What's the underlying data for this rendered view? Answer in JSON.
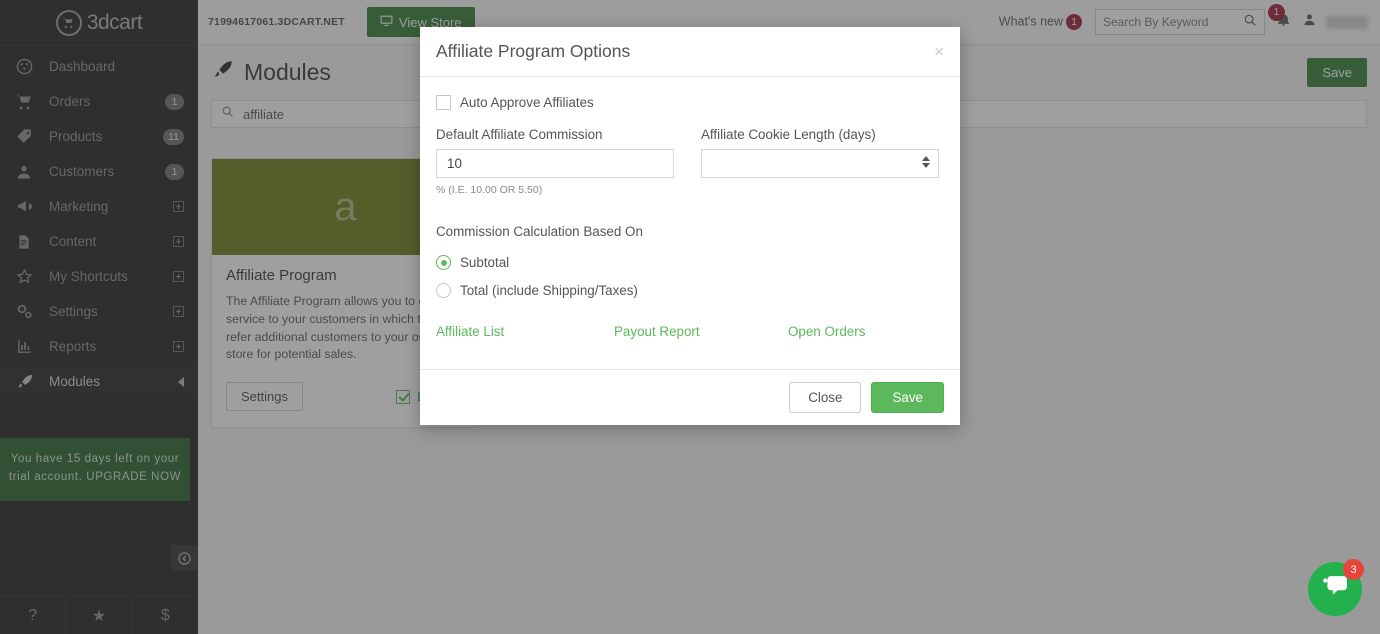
{
  "sidebar": {
    "brand": "3dcart",
    "items": [
      {
        "label": "Dashboard",
        "icon": "gauge-icon",
        "badge": null,
        "expandable": false,
        "active": false
      },
      {
        "label": "Orders",
        "icon": "cart-icon",
        "badge": "1",
        "expandable": false,
        "active": false
      },
      {
        "label": "Products",
        "icon": "tag-icon",
        "badge": "11",
        "expandable": false,
        "active": false
      },
      {
        "label": "Customers",
        "icon": "user-icon",
        "badge": "1",
        "expandable": false,
        "active": false
      },
      {
        "label": "Marketing",
        "icon": "megaphone-icon",
        "badge": null,
        "expandable": true,
        "active": false
      },
      {
        "label": "Content",
        "icon": "document-icon",
        "badge": null,
        "expandable": true,
        "active": false
      },
      {
        "label": "My Shortcuts",
        "icon": "star-icon",
        "badge": null,
        "expandable": true,
        "active": false
      },
      {
        "label": "Settings",
        "icon": "gears-icon",
        "badge": null,
        "expandable": true,
        "active": false
      },
      {
        "label": "Reports",
        "icon": "bar-chart-icon",
        "badge": null,
        "expandable": true,
        "active": false
      },
      {
        "label": "Modules",
        "icon": "rocket-icon",
        "badge": null,
        "expandable": false,
        "active": true
      }
    ],
    "trial_notice": "You have 15 days left on your trial account. UPGRADE NOW",
    "footer_icons": [
      {
        "name": "help-icon",
        "glyph": "?"
      },
      {
        "name": "star-icon",
        "glyph": "★"
      },
      {
        "name": "dollar-icon",
        "glyph": "$"
      }
    ]
  },
  "topbar": {
    "store_url": "71994617061.3DCART.NET",
    "view_store_label": "View Store",
    "whats_new_label": "What's new",
    "whats_new_count": "1",
    "search_placeholder": "Search By Keyword",
    "search_value": "",
    "notification_count": "1"
  },
  "page": {
    "title": "Modules",
    "save_label": "Save",
    "search_value": "affiliate",
    "search_placeholder": "Search"
  },
  "card": {
    "thumb_letter": "a",
    "title": "Affiliate Program",
    "description": "The Affiliate Program allows you to offer a service to your customers in which they can refer additional customers to your online store for potential sales.",
    "settings_label": "Settings",
    "enabled_label": "Enabled",
    "enabled": true
  },
  "modal": {
    "title": "Affiliate Program Options",
    "close_glyph": "×",
    "auto_approve_label": "Auto Approve Affiliates",
    "auto_approve_checked": false,
    "commission_label": "Default Affiliate Commission",
    "commission_value": "10",
    "commission_hint": "% (I.E. 10.00 OR 5.50)",
    "cookie_label": "Affiliate Cookie Length (days)",
    "cookie_value": "",
    "calc_section_label": "Commission Calculation Based On",
    "radios": [
      {
        "label": "Subtotal",
        "selected": true
      },
      {
        "label": "Total (include Shipping/Taxes)",
        "selected": false
      }
    ],
    "links": [
      {
        "label": "Affiliate List"
      },
      {
        "label": "Payout Report"
      },
      {
        "label": "Open Orders"
      }
    ],
    "close_label": "Close",
    "save_label": "Save"
  },
  "chat": {
    "badge": "3"
  },
  "colors": {
    "brand_green": "#2e7d32",
    "accent_green": "#5cb85c",
    "sidebar_bg": "#1e1e1e",
    "badge_red": "#9c1733",
    "thumb_olive": "#6b7a14"
  }
}
